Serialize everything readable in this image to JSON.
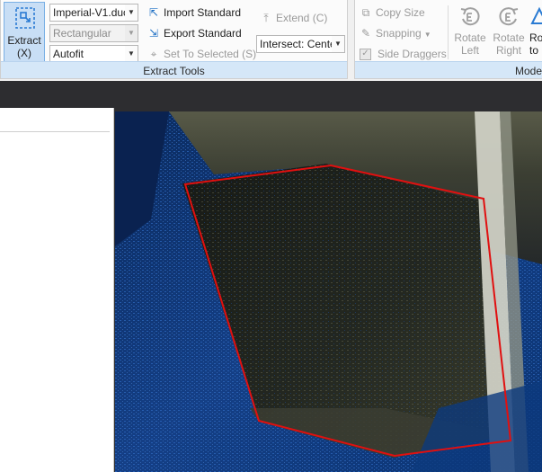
{
  "ribbon": {
    "extract_tools": {
      "extract_button": {
        "label_line1": "Extract",
        "label_line2": "(X)"
      },
      "standard_combo": {
        "value": "Imperial-V1.duc"
      },
      "shape_combo": {
        "value": "Rectangular"
      },
      "fit_combo": {
        "value": "Autofit"
      },
      "import_standard": "Import Standard",
      "export_standard": "Export Standard",
      "set_to_selected": "Set To Selected (S)",
      "extend": "Extend (C)",
      "intersect_combo": {
        "value": "Intersect: Cente"
      },
      "group_label": "Extract Tools"
    },
    "modify": {
      "copy_size": "Copy Size",
      "snapping": "Snapping",
      "side_draggers": "Side Draggers",
      "rotate_left": {
        "line1": "Rotate",
        "line2": "Left"
      },
      "rotate_right": {
        "line1": "Rotate",
        "line2": "Right"
      },
      "rotate_to": {
        "line1": "Ro",
        "line2": "to"
      },
      "group_label": "Mode"
    }
  },
  "colors": {
    "accent": "#1d6fc4",
    "footer": "#d5e7f8",
    "selection": "#e01010"
  },
  "icons": [
    "extract-icon",
    "import-icon",
    "export-icon",
    "target-icon",
    "extend-icon",
    "copy-size-icon",
    "snapping-icon",
    "checkbox-icon",
    "rotate-left-icon",
    "rotate-right-icon",
    "rotate-to-icon"
  ]
}
